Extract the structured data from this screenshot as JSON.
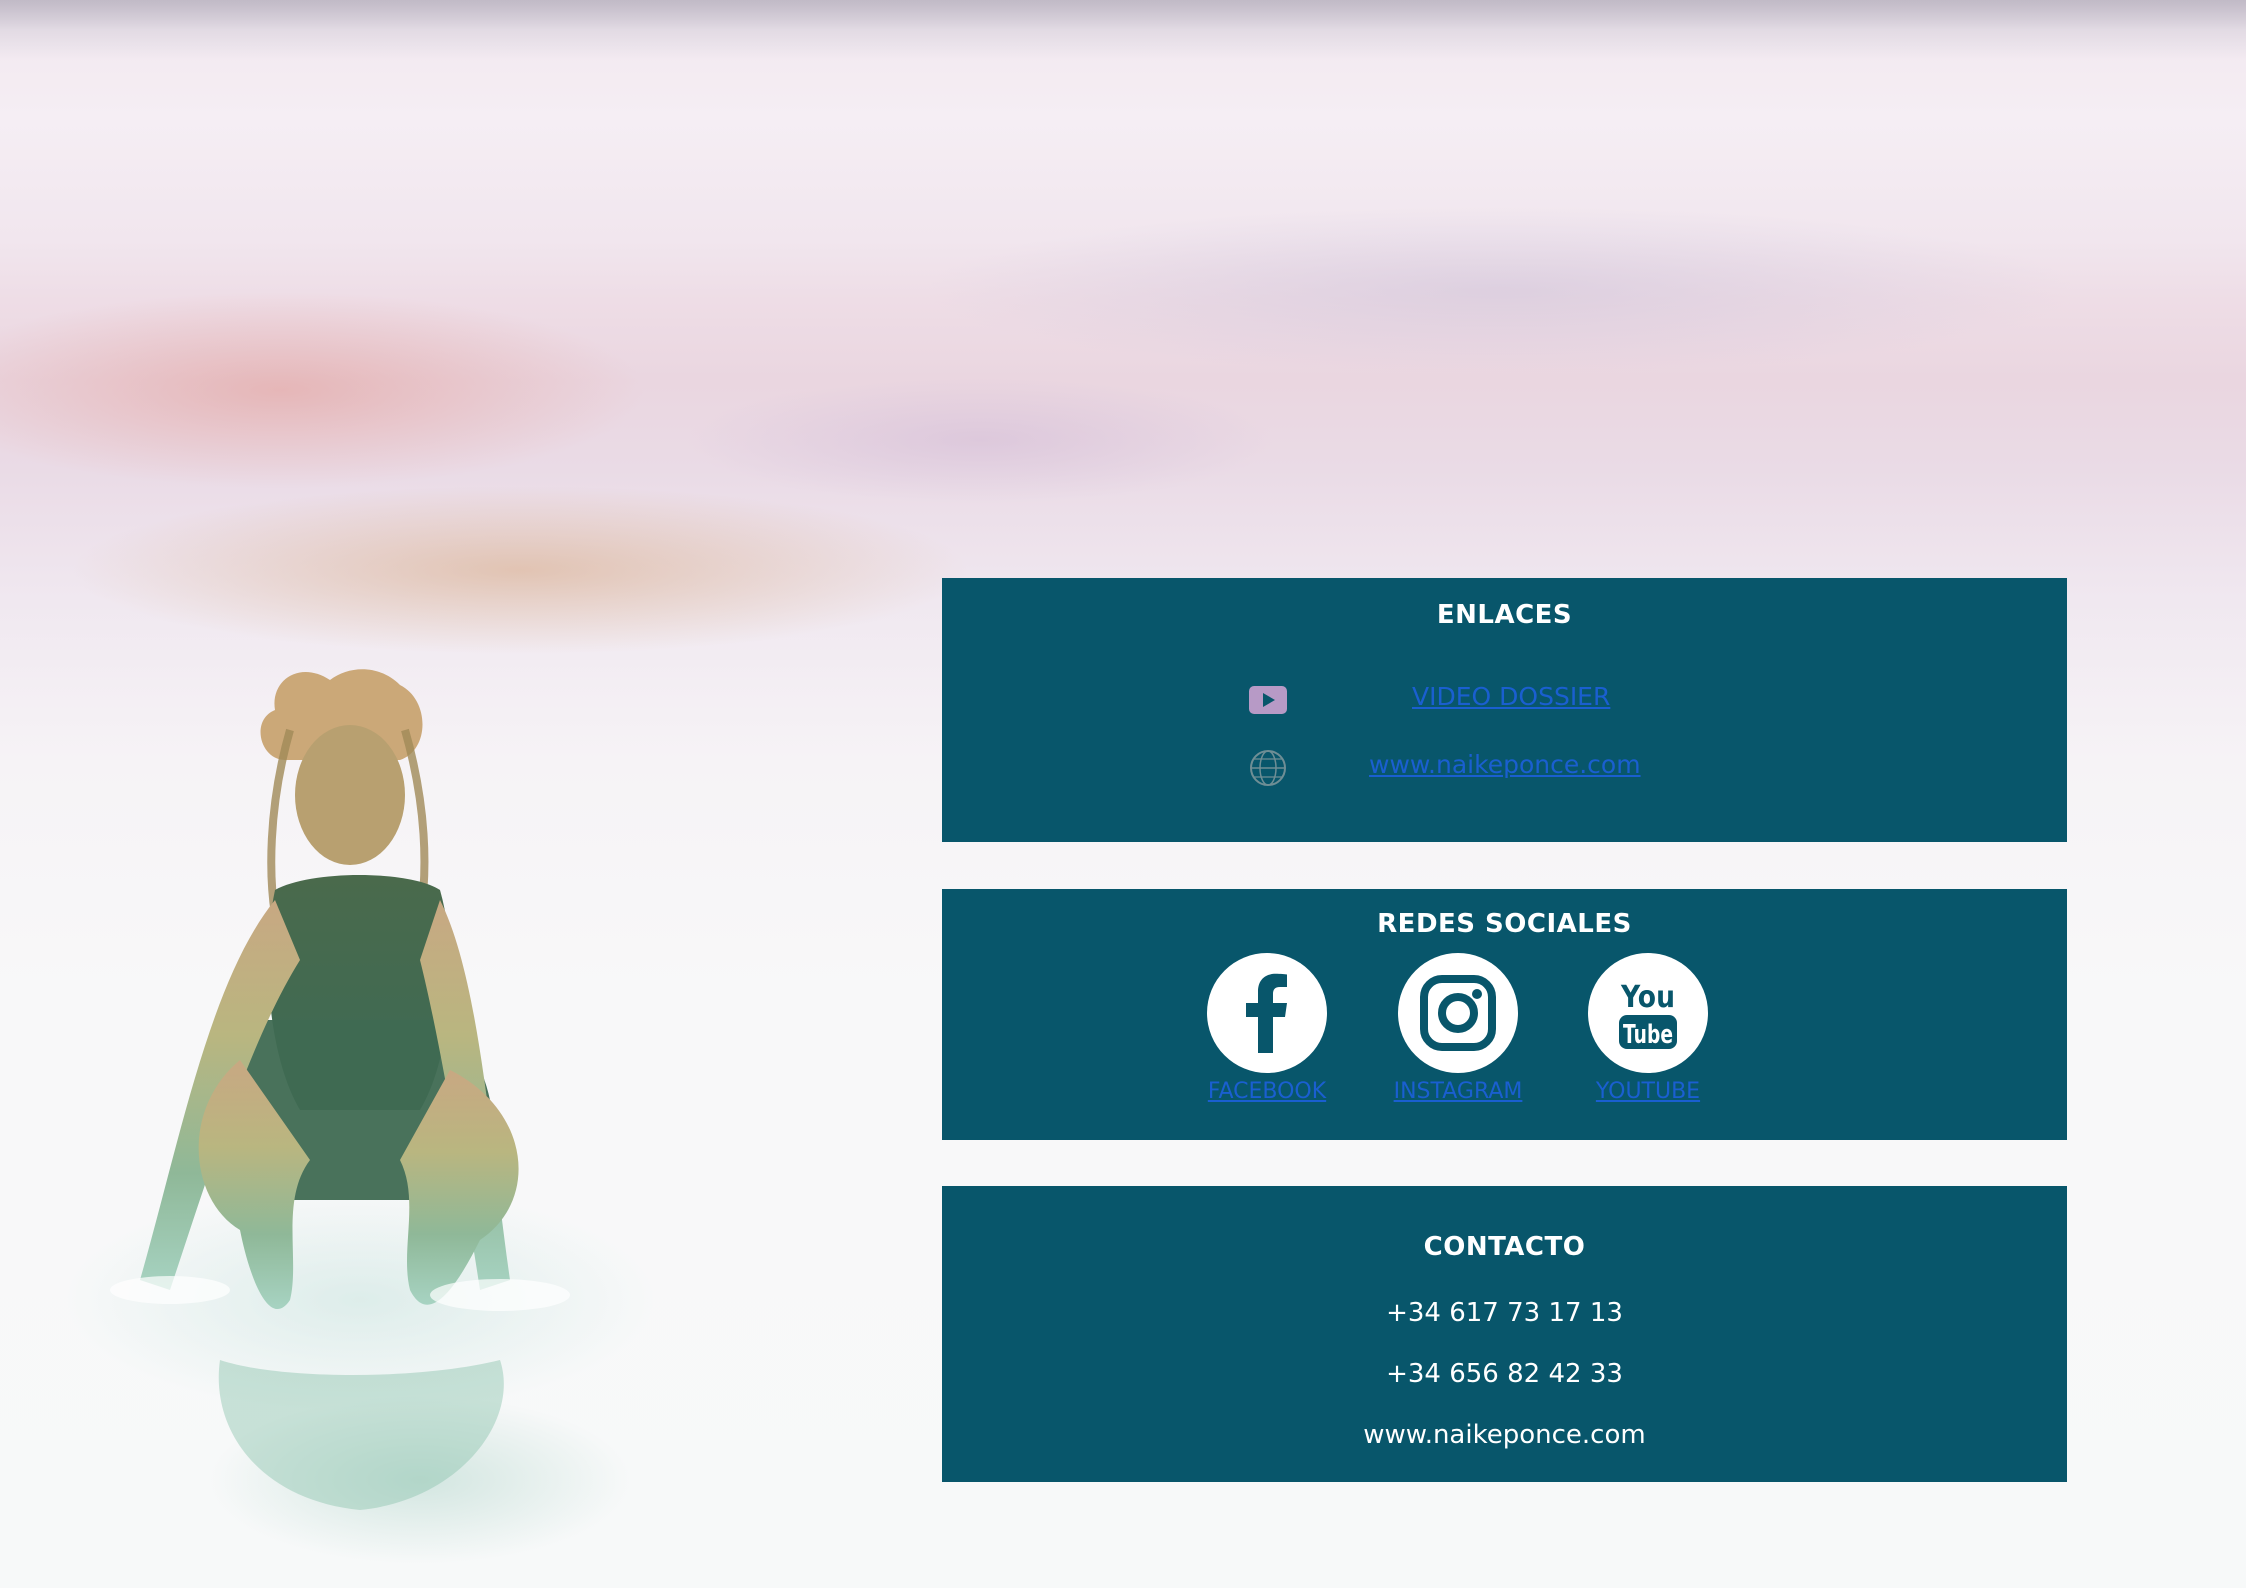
{
  "links_panel": {
    "title": "ENLACES",
    "items": [
      {
        "icon": "play-icon",
        "label": "VIDEO DOSSIER"
      },
      {
        "icon": "globe-icon",
        "label": "www.naikeponce.com"
      }
    ]
  },
  "social_panel": {
    "title": "REDES SOCIALES",
    "items": [
      {
        "icon": "facebook-icon",
        "label": "FACEBOOK"
      },
      {
        "icon": "instagram-icon",
        "label": "INSTAGRAM"
      },
      {
        "icon": "youtube-icon",
        "label": "YOUTUBE",
        "logo_text_top": "You",
        "logo_text_bottom": "Tube"
      }
    ]
  },
  "contact_panel": {
    "title": "CONTACTO",
    "phone_1": "+34 617 73 17 13",
    "phone_2": "+34 656 82 42 33",
    "website": "www.naikeponce.com"
  },
  "colors": {
    "panel_background": "#08566b",
    "link_color": "#1a5fd0",
    "text_color": "#ffffff"
  }
}
